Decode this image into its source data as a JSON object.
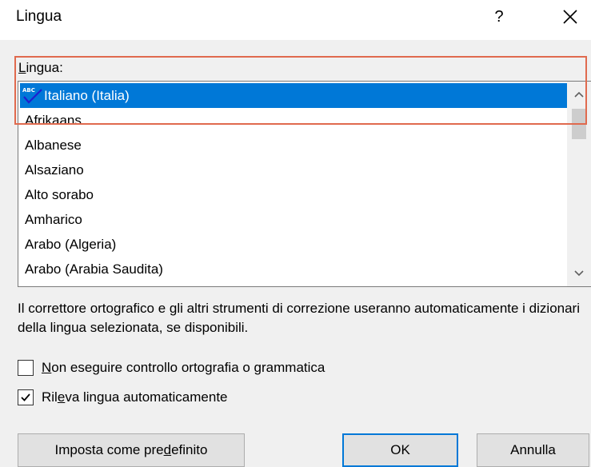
{
  "window": {
    "title": "Lingua",
    "help_label": "?"
  },
  "language": {
    "label_prefix": "L",
    "label_rest": "ingua:",
    "selected": "Italiano (Italia)",
    "items": [
      "Italiano (Italia)",
      "Afrikaans",
      "Albanese",
      "Alsaziano",
      "Alto sorabo",
      "Amharico",
      "Arabo (Algeria)",
      "Arabo (Arabia Saudita)"
    ]
  },
  "description": "Il correttore ortografico e gli altri strumenti di correzione useranno automaticamente i dizionari della lingua selezionata, se disponibili.",
  "options": {
    "no_proofing": {
      "underline": "N",
      "rest": "on eseguire controllo ortografia o grammatica",
      "checked": false
    },
    "detect_language": {
      "before": "Ril",
      "underline": "e",
      "after": "va lingua automaticamente",
      "checked": true
    }
  },
  "buttons": {
    "set_default_before": "Imposta come pre",
    "set_default_underline": "d",
    "set_default_after": "efinito",
    "ok": "OK",
    "cancel": "Annulla"
  },
  "colors": {
    "selection": "#0078d7",
    "highlight_annotation": "#e06a4e"
  },
  "icons": {
    "spell_check": "spell-check-icon",
    "scroll_up": "chevron-up-icon",
    "scroll_down": "chevron-down-icon",
    "close": "close-icon"
  }
}
